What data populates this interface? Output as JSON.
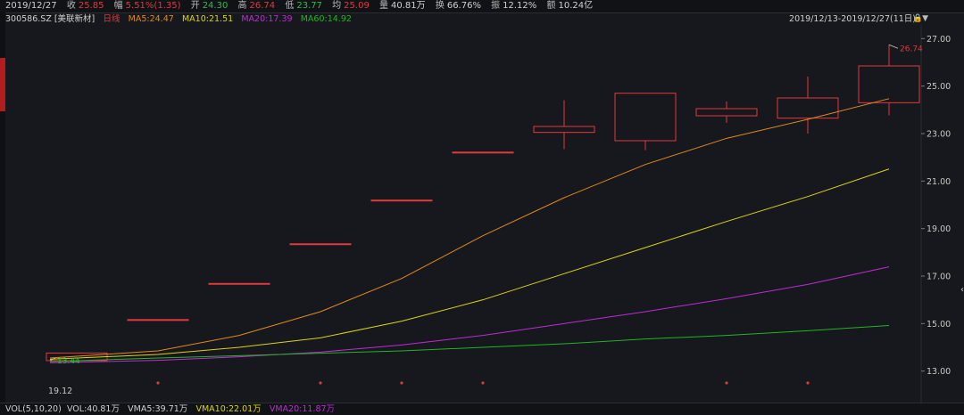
{
  "header": {
    "date": "2019/12/27",
    "close": {
      "label": "收",
      "value": "25.85"
    },
    "change": {
      "label": "幅",
      "value": "5.51%(1.35)"
    },
    "open": {
      "label": "开",
      "value": "24.30"
    },
    "high": {
      "label": "高",
      "value": "26.74"
    },
    "low": {
      "label": "低",
      "value": "23.77"
    },
    "avg": {
      "label": "均",
      "value": "25.09"
    },
    "volume": {
      "label": "量",
      "value": "40.81万"
    },
    "turnover": {
      "label": "换",
      "value": "66.76%"
    },
    "amplitude": {
      "label": "振",
      "value": "12.12%"
    },
    "amount": {
      "label": "额",
      "value": "10.24亿"
    }
  },
  "ma_bar": {
    "code": "300586.SZ [美联新材]",
    "period": "日线",
    "ma5": "MA5:24.47",
    "ma10": "MA10:21.51",
    "ma20": "MA20:17.39",
    "ma60": "MA60:14.92"
  },
  "range_label": "2019/12/13-2019/12/27(11日)",
  "range_control": "▼",
  "lock_icon": "lock-icon",
  "date_label": "19.12",
  "volume_bar": {
    "title": "VOL(5,10,20)",
    "vol": "VOL:40.81万",
    "vma5": "VMA5:39.71万",
    "vma10": "VMA10:22.01万",
    "vma20": "VMA20:11.87万"
  },
  "colors": {
    "up": "#e0393e",
    "down": "#2bbf4a",
    "ma5": "#e08a1e",
    "ma10": "#dcd414",
    "ma20": "#c02bd6",
    "ma60": "#22b522",
    "text": "#c8c8c8",
    "background": "#16181d",
    "grid": "#2a2d33"
  },
  "chart_data": {
    "type": "candlestick",
    "ylim": [
      12.5,
      27.5
    ],
    "y_ticks": [
      "13.00",
      "15.00",
      "17.00",
      "19.00",
      "21.00",
      "23.00",
      "25.00",
      "27.00"
    ],
    "candles": [
      {
        "open": 13.44,
        "high": 13.76,
        "low": 13.44,
        "close": 13.76
      },
      {
        "open": 15.17,
        "high": 15.17,
        "low": 15.17,
        "close": 15.17
      },
      {
        "open": 16.69,
        "high": 16.69,
        "low": 16.69,
        "close": 16.69
      },
      {
        "open": 18.36,
        "high": 18.36,
        "low": 18.36,
        "close": 18.36
      },
      {
        "open": 20.2,
        "high": 20.2,
        "low": 20.2,
        "close": 20.2
      },
      {
        "open": 22.22,
        "high": 22.22,
        "low": 22.22,
        "close": 22.22
      },
      {
        "open": 23.05,
        "high": 24.4,
        "low": 22.35,
        "close": 23.3
      },
      {
        "open": 22.7,
        "high": 24.7,
        "low": 22.3,
        "close": 24.7
      },
      {
        "open": 23.75,
        "high": 24.35,
        "low": 23.45,
        "close": 24.05
      },
      {
        "open": 23.65,
        "high": 25.4,
        "low": 23.0,
        "close": 24.5
      },
      {
        "open": 24.3,
        "high": 26.74,
        "low": 23.77,
        "close": 25.85
      }
    ],
    "ma5": [
      13.55,
      13.85,
      14.5,
      15.5,
      16.9,
      18.7,
      20.3,
      21.7,
      22.8,
      23.6,
      24.47
    ],
    "ma10": [
      13.5,
      13.7,
      14.0,
      14.4,
      15.1,
      16.0,
      17.1,
      18.2,
      19.3,
      20.35,
      21.51
    ],
    "ma20": [
      13.35,
      13.45,
      13.6,
      13.8,
      14.1,
      14.5,
      15.0,
      15.5,
      16.05,
      16.65,
      17.39
    ],
    "ma60": [
      13.4,
      13.55,
      13.65,
      13.75,
      13.85,
      14.0,
      14.15,
      14.35,
      14.5,
      14.7,
      14.92
    ],
    "high_marker": "26.74",
    "low_marker": "13.44",
    "event_markers": [
      1,
      3,
      4,
      5,
      8,
      9
    ]
  }
}
